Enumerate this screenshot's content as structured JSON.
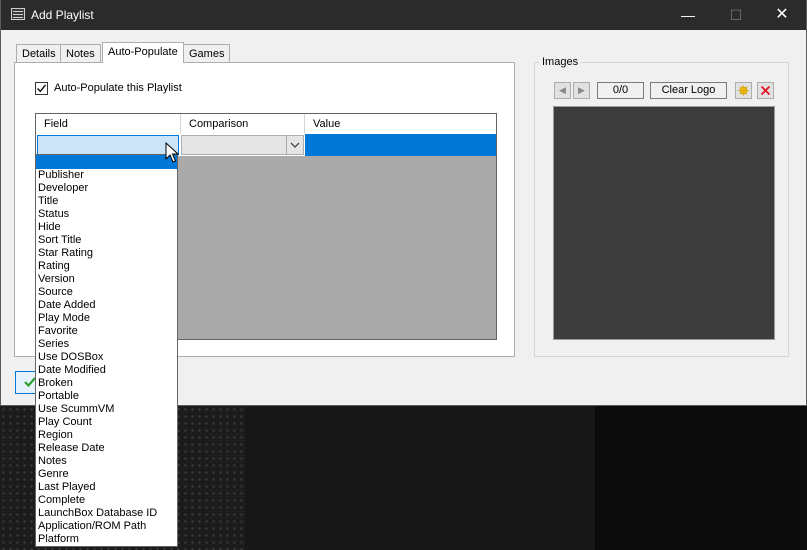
{
  "window": {
    "title": "Add Playlist"
  },
  "tabs": [
    {
      "label": "Details"
    },
    {
      "label": "Notes"
    },
    {
      "label": "Auto-Populate",
      "active": true
    },
    {
      "label": "Games"
    }
  ],
  "auto_populate": {
    "checkbox_label": "Auto-Populate this Playlist",
    "checked": true,
    "columns": [
      "Field",
      "Comparison",
      "Value"
    ],
    "field_options": [
      "",
      "Publisher",
      "Developer",
      "Title",
      "Status",
      "Hide",
      "Sort Title",
      "Star Rating",
      "Rating",
      "Version",
      "Source",
      "Date Added",
      "Play Mode",
      "Favorite",
      "Series",
      "Use DOSBox",
      "Date Modified",
      "Broken",
      "Portable",
      "Use ScummVM",
      "Play Count",
      "Region",
      "Release Date",
      "Notes",
      "Genre",
      "Last Played",
      "Complete",
      "LaunchBox Database ID",
      "Application/ROM Path",
      "Platform"
    ]
  },
  "images": {
    "group_title": "Images",
    "counter": "0/0",
    "clear_logo_label": "Clear Logo"
  },
  "colors": {
    "accent": "#0078d7",
    "titlebar": "#2b2b2b",
    "delete": "#e81123"
  }
}
